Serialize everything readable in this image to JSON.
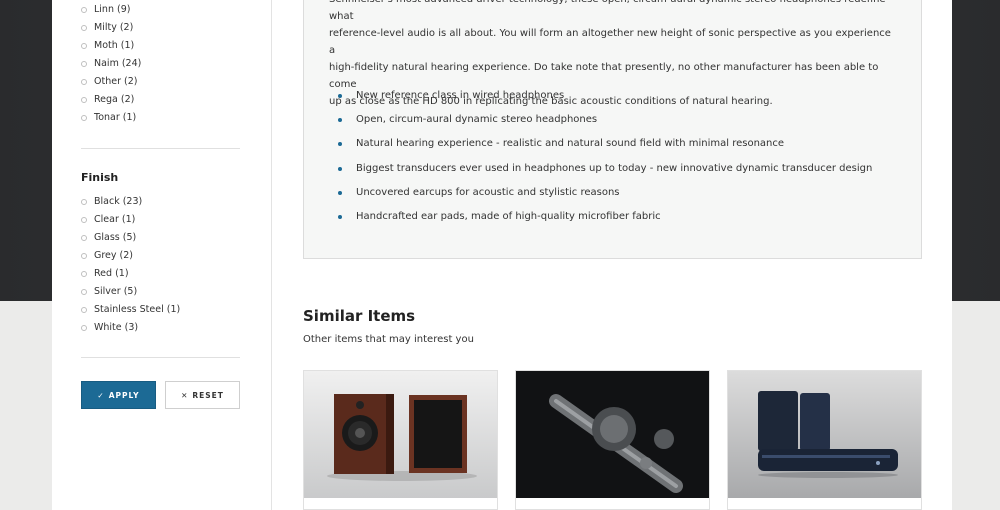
{
  "filters": {
    "brands": [
      {
        "label": "Linn (9)"
      },
      {
        "label": "Milty (2)"
      },
      {
        "label": "Moth (1)"
      },
      {
        "label": "Naim (24)"
      },
      {
        "label": "Other (2)"
      },
      {
        "label": "Rega (2)"
      },
      {
        "label": "Tonar (1)"
      }
    ],
    "finish_title": "Finish",
    "finish": [
      {
        "label": "Black (23)"
      },
      {
        "label": "Clear (1)"
      },
      {
        "label": "Glass (5)"
      },
      {
        "label": "Grey (2)"
      },
      {
        "label": "Red (1)"
      },
      {
        "label": "Silver (5)"
      },
      {
        "label": "Stainless Steel (1)"
      },
      {
        "label": "White (3)"
      }
    ],
    "apply_label": "APPLY",
    "reset_label": "RESET",
    "apply_icon": "check-icon",
    "reset_icon": "close-icon"
  },
  "description": {
    "line1": "Sennheiser's most advanced driver technology, these open, circum-aural dynamic stereo headphones redefine what",
    "line2": "reference-level audio is all about. You will form an altogether new height of sonic perspective as you experience a",
    "line3": "high-fidelity natural hearing experience. Do take note that presently, no other manufacturer has been able to come",
    "line4": "up as close as the HD 800 in replicating the basic acoustic conditions of natural hearing.",
    "features": [
      "New reference class in wired headphones",
      "Open, circum-aural dynamic stereo headphones",
      "Natural hearing experience - realistic and natural sound field with minimal resonance",
      "Biggest transducers ever used in headphones up to today - new innovative dynamic transducer design",
      "Uncovered earcups for acoustic and stylistic reasons",
      "Handcrafted ear pads, made of high-quality microfiber fabric"
    ]
  },
  "similar": {
    "title": "Similar Items",
    "subtitle": "Other items that may interest you"
  },
  "colors": {
    "accent": "#1c6a95",
    "dark_bg": "#2e3033",
    "light_bg": "#ebebea"
  }
}
